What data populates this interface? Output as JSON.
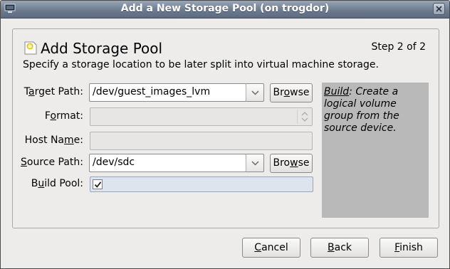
{
  "window": {
    "title": "Add a New Storage Pool (on trogdor)"
  },
  "header": {
    "title": "Add Storage Pool",
    "step": "Step 2 of 2",
    "subtitle": "Specify a storage location to be later split into virtual machine storage."
  },
  "form": {
    "target_path": {
      "pre": "T",
      "mn": "a",
      "post": "rget Path:",
      "value": "/dev/guest_images_lvm"
    },
    "format": {
      "pre": "F",
      "mn": "o",
      "post": "rmat:",
      "value": ""
    },
    "host_name": {
      "pre": "Host Na",
      "mn": "m",
      "post": "e:",
      "value": ""
    },
    "source_path": {
      "pre": "",
      "mn": "S",
      "post": "ource Path:",
      "value": "/dev/sdc"
    },
    "build_pool": {
      "pre": "B",
      "mn": "u",
      "post": "ild Pool:",
      "checked": true
    }
  },
  "buttons": {
    "browse1": {
      "pre": "Br",
      "mn": "o",
      "post": "wse"
    },
    "browse2": {
      "pre": "Bro",
      "mn": "w",
      "post": "se"
    },
    "cancel": {
      "pre": "",
      "mn": "C",
      "post": "ancel"
    },
    "back": {
      "pre": "",
      "mn": "B",
      "post": "ack"
    },
    "finish": {
      "pre": "",
      "mn": "F",
      "post": "inish"
    }
  },
  "help": {
    "key": "Build",
    "text": ": Create a logical volume group from the source device."
  },
  "icons": {
    "window": "window-app-icon",
    "close": "close-icon",
    "header": "storage-pool-icon",
    "dropdown": "chevron-down-icon",
    "spinner": "spin-arrows-icon",
    "check": "check-icon"
  },
  "colors": {
    "titlebar": "#6d7b90",
    "background": "#edeceb",
    "help_box": "#b9b9b9",
    "check_field": "#dde4ee"
  }
}
